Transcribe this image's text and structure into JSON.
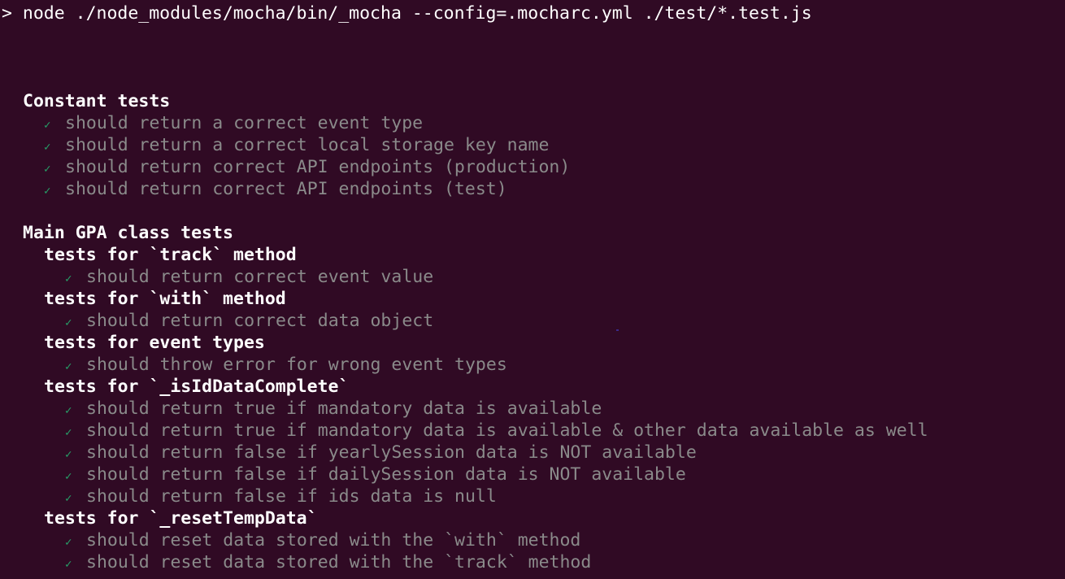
{
  "command": {
    "prompt": ">",
    "text": "node ./node_modules/mocha/bin/_mocha --config=.mocharc.yml ./test/*.test.js"
  },
  "check_mark": "✓",
  "colors": {
    "background": "#300a24",
    "pass_check": "#26a269",
    "test_text": "#8a8a8a",
    "heading_text": "#ffffff"
  },
  "suites": {
    "constant": {
      "title": "Constant tests",
      "tests": [
        "should return a correct event type",
        "should return a correct local storage key name",
        "should return correct API endpoints (production)",
        "should return correct API endpoints (test)"
      ]
    },
    "main": {
      "title": "Main GPA class tests",
      "groups": [
        {
          "title": "tests for `track` method",
          "tests": [
            "should return correct event value"
          ]
        },
        {
          "title": "tests for `with` method",
          "tests": [
            "should return correct data object"
          ]
        },
        {
          "title": "tests for event types",
          "tests": [
            "should throw error for wrong event types"
          ]
        },
        {
          "title": "tests for `_isIdDataComplete`",
          "tests": [
            "should return true if mandatory data is available",
            "should return true if mandatory data is available & other data available as well",
            "should return false if yearlySession data is NOT available",
            "should return false if dailySession data is NOT available",
            "should return false if ids data is null"
          ]
        },
        {
          "title": "tests for `_resetTempData`",
          "tests": [
            "should reset data stored with the `with` method",
            "should reset data stored with the `track` method"
          ]
        }
      ]
    }
  }
}
